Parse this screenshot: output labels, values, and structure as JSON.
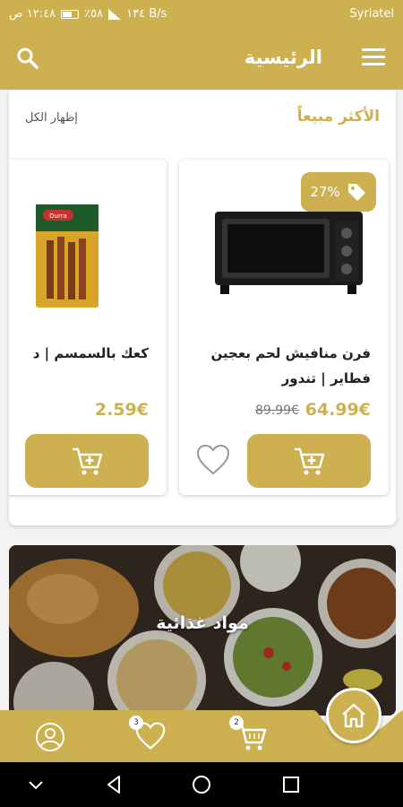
{
  "status_bar": {
    "carrier": "Syriatel",
    "speed": "١٣٤ B/s",
    "battery": "٪٥٨",
    "time": "١٢:٤٨ ص"
  },
  "app_bar": {
    "title": "الرئيسية"
  },
  "best_sellers": {
    "title": "الأكثر مبيعاً",
    "show_all": "إظهار الكل",
    "products": [
      {
        "name": "فرن منافيش لحم بعجين فطاير | تندور",
        "price": "64.99€",
        "old_price": "89.99€",
        "discount": "27%"
      },
      {
        "name": "كعك بالسمسم | د",
        "price": "2.59€",
        "image_brand": "Durra"
      }
    ]
  },
  "category_banner": {
    "label": "مواد غذائية"
  },
  "bottom_nav": {
    "favorites_count": "3",
    "cart_count": "2"
  },
  "colors": {
    "brand": "#cdb04f",
    "text": "#222222"
  },
  "icons": [
    "menu-icon",
    "search-icon",
    "tag-icon",
    "cart-plus-icon",
    "heart-icon",
    "user-icon",
    "cart-icon",
    "home-icon",
    "back-icon",
    "circle-home-icon",
    "recents-icon"
  ]
}
